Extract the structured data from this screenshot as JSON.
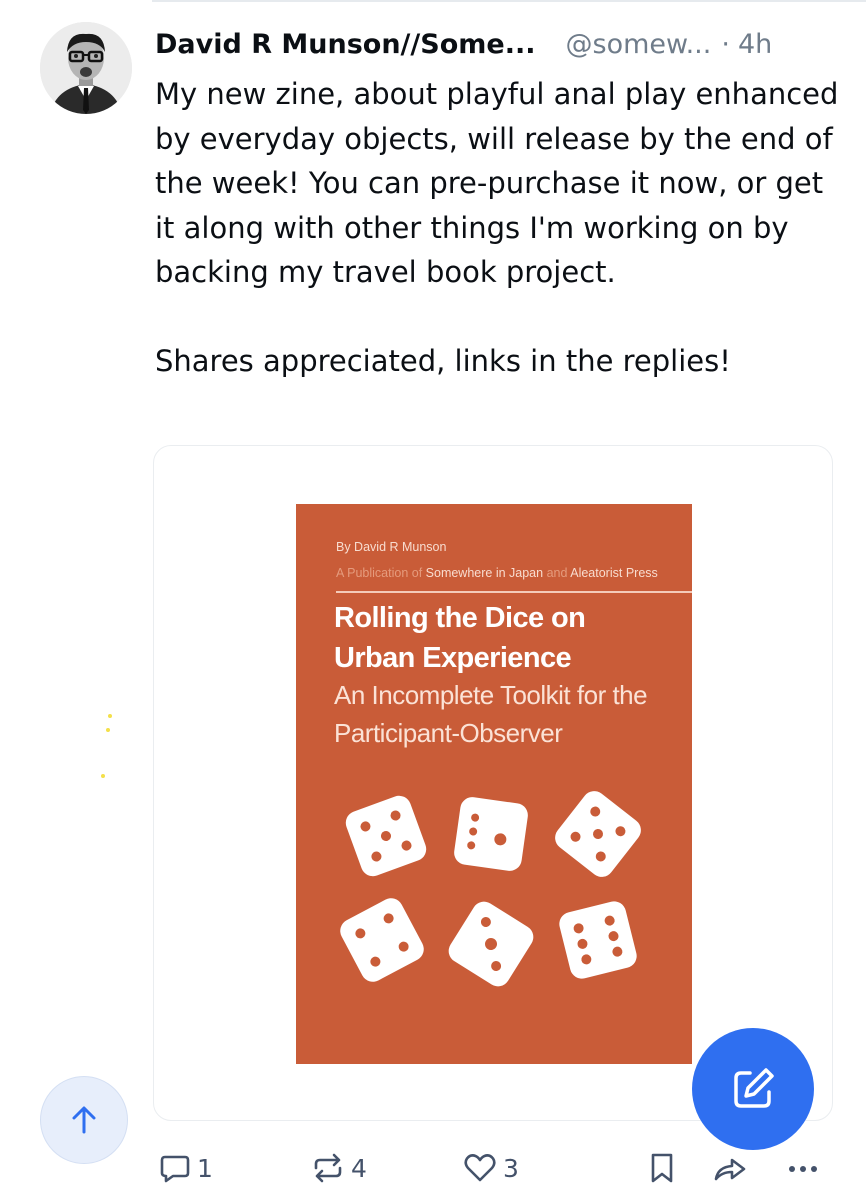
{
  "post": {
    "author_name": "David R Munson//Some...",
    "handle": "@somew...",
    "separator": "·",
    "age": "4h",
    "text_paragraphs": [
      "My new zine, about playful anal play enhanced by everyday objects, will release by the end of the week! You can pre-purchase it now, or get it along with other things I'm working on by backing my travel book project.",
      "Shares appreciated, links in the replies!"
    ]
  },
  "embed": {
    "cover": {
      "byline": "By David R Munson",
      "publication_prefix": "A Publication of",
      "publisher_1": "Somewhere in Japan",
      "publication_and": "and",
      "publisher_2": "Aleatorist Press",
      "title_line_1": "Rolling the Dice on",
      "title_line_2": "Urban Experience",
      "subtitle_line_1": "An Incomplete Toolkit for the",
      "subtitle_line_2": "Participant-Observer"
    }
  },
  "actions": {
    "reply_count": "1",
    "repost_count": "4",
    "like_count": "3"
  },
  "icons": {
    "reply": "reply-icon",
    "repost": "repost-icon",
    "like": "heart-icon",
    "bookmark": "bookmark-icon",
    "share": "share-icon",
    "more": "more-icon",
    "scroll_top": "arrow-up-icon",
    "compose": "compose-icon"
  },
  "colors": {
    "accent": "#2f6ff0",
    "cover_background": "#c95c38",
    "muted_text": "#6f7c8a",
    "action_icon": "#44526a"
  }
}
